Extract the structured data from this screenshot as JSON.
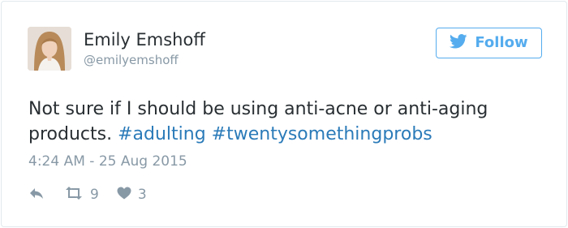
{
  "tweet": {
    "author": {
      "display_name": "Emily Emshoff",
      "handle": "@emilyemshoff",
      "avatar_icon": "profile-photo"
    },
    "follow_button": {
      "label": "Follow",
      "icon": "twitter-bird-icon"
    },
    "text": {
      "plain": "Not sure if I should be using anti-acne or anti-aging products. ",
      "hashtags": [
        "#adulting",
        "#twentysomethingprobs"
      ]
    },
    "timestamp": "4:24 AM - 25 Aug 2015",
    "actions": {
      "reply_icon": "reply-icon",
      "retweet_icon": "retweet-icon",
      "retweet_count": "9",
      "like_icon": "heart-icon",
      "like_count": "3"
    }
  },
  "colors": {
    "brand_blue": "#55acee",
    "link_blue": "#2b7bb9",
    "text_dark": "#292f33",
    "text_muted": "#8899a6",
    "border": "#e1e8ed"
  }
}
